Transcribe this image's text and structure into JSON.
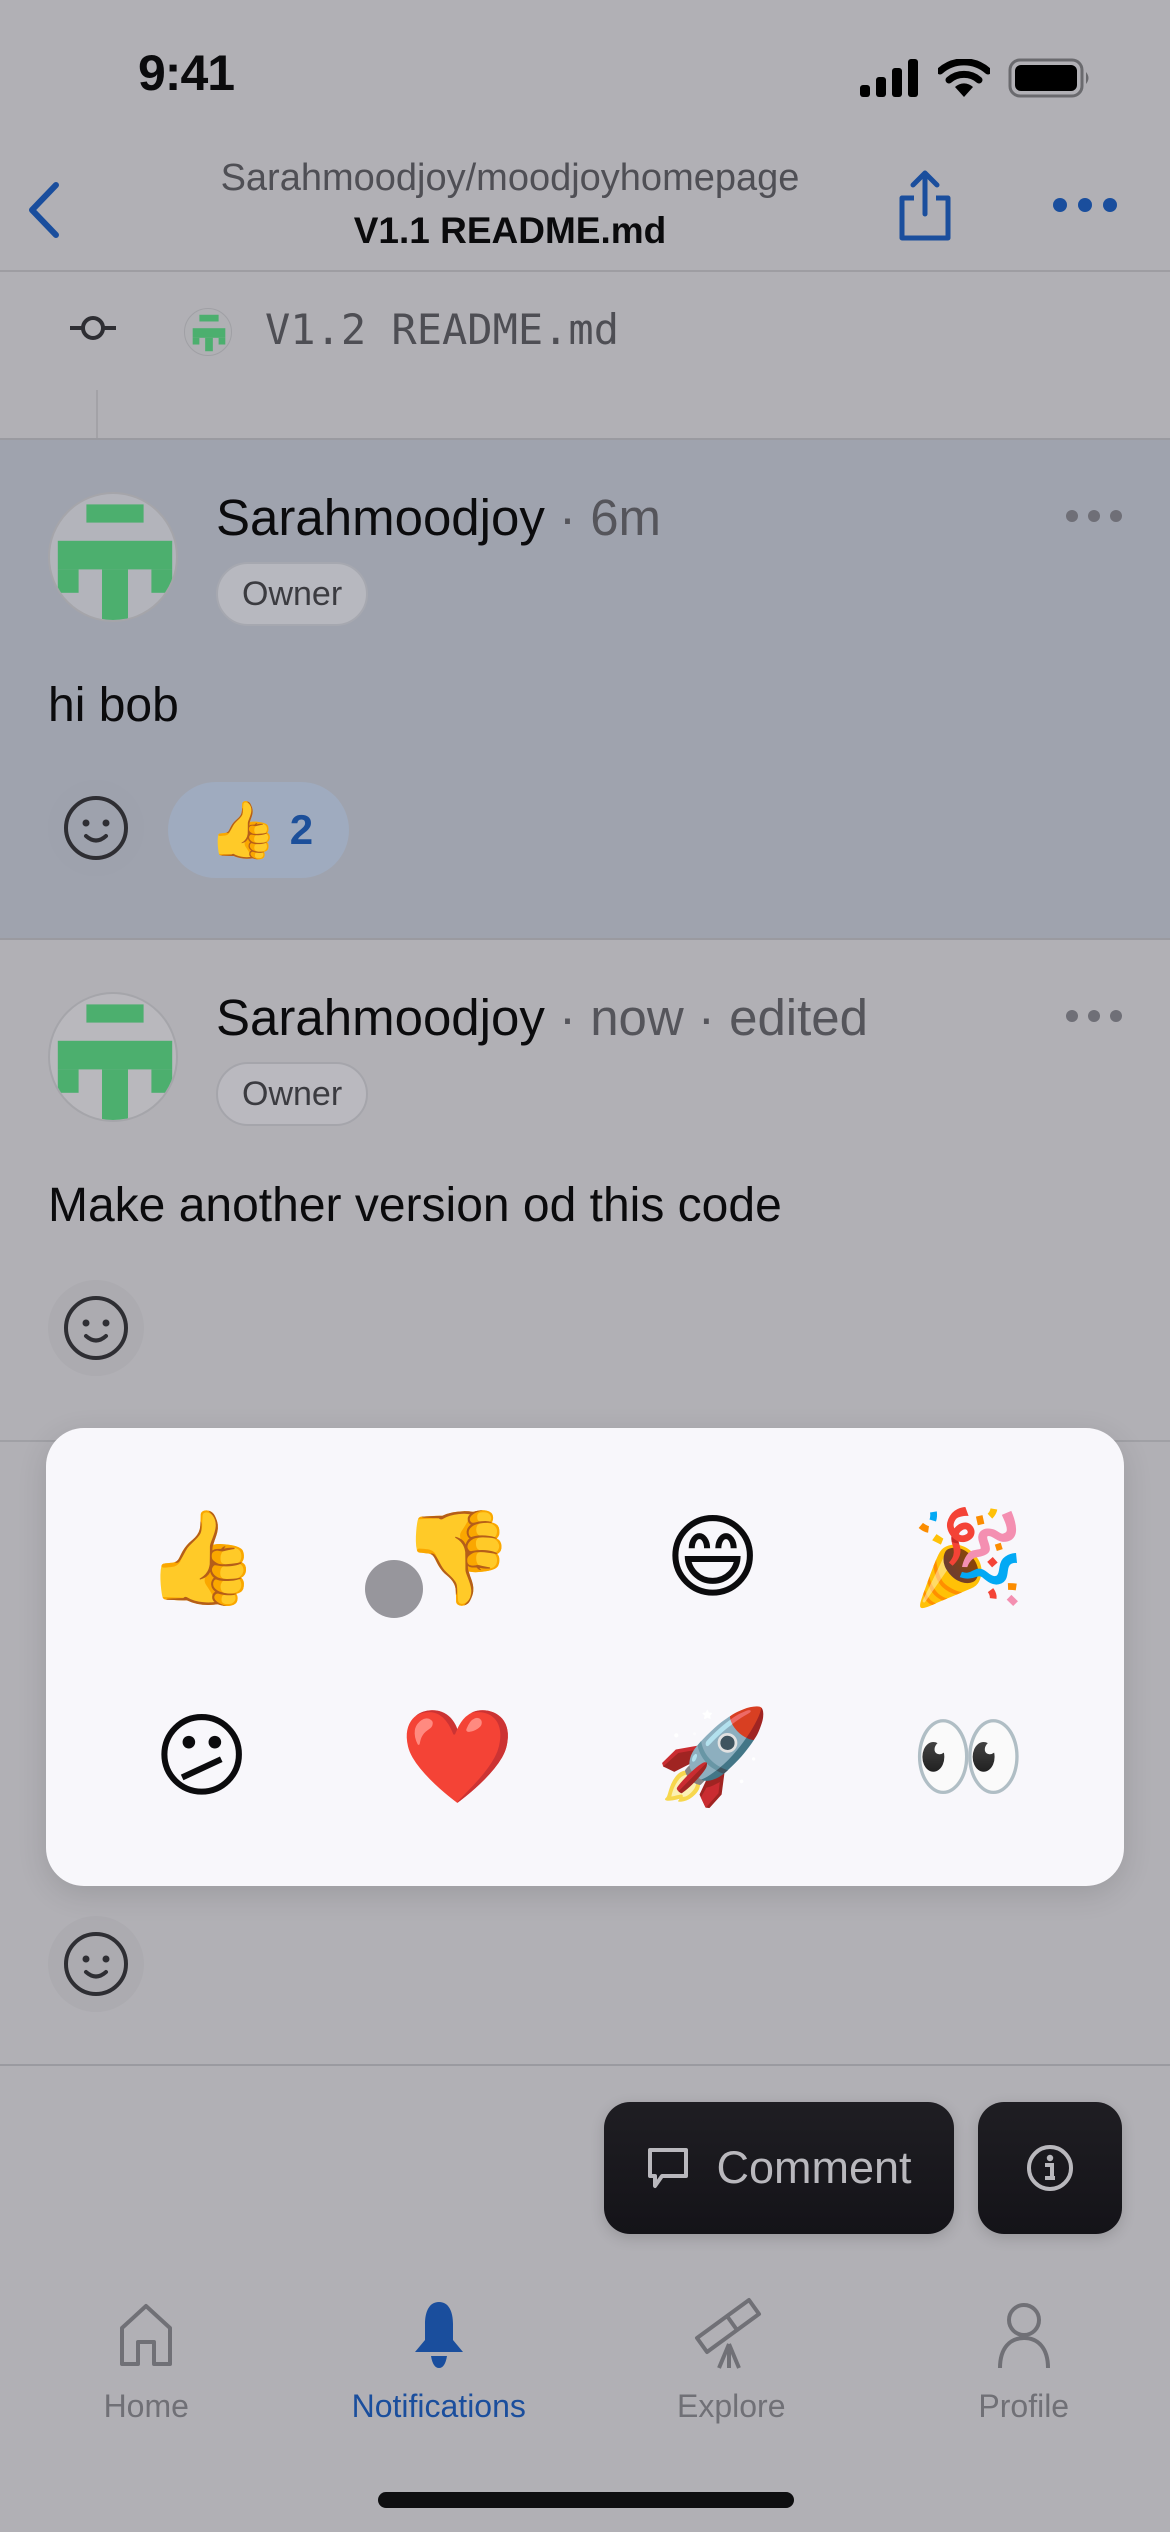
{
  "status_bar": {
    "time": "9:41",
    "signal_icon": "cellular-signal-icon",
    "wifi_icon": "wifi-icon",
    "battery_icon": "battery-icon"
  },
  "header": {
    "back_icon": "chevron-left-icon",
    "repo": "Sarahmoodjoy/moodjoyhomepage",
    "title": "V1.1 README.md",
    "share_icon": "share-icon",
    "more_icon": "ellipsis-icon"
  },
  "commit": {
    "icon": "git-commit-icon",
    "label": "V1.2 README.md"
  },
  "comments": [
    {
      "author": "Sarahmoodjoy",
      "meta": " · 6m",
      "badge": "Owner",
      "body": "hi bob",
      "highlighted": true,
      "reactions": [
        {
          "emoji": "👍",
          "name": "thumbs-up",
          "count": "2"
        }
      ]
    },
    {
      "author": "Sarahmoodjoy",
      "meta": " · now · edited",
      "badge": "Owner",
      "body": "Make another version od this code",
      "highlighted": false,
      "reactions": []
    },
    {
      "reactions": []
    }
  ],
  "emoji_picker": {
    "options": [
      {
        "emoji": "👍",
        "name": "thumbs-up"
      },
      {
        "emoji": "👎",
        "name": "thumbs-down"
      },
      {
        "emoji": "😄",
        "name": "laugh"
      },
      {
        "emoji": "🎉",
        "name": "hooray"
      },
      {
        "emoji": "😕",
        "name": "confused"
      },
      {
        "emoji": "❤️",
        "name": "heart"
      },
      {
        "emoji": "🚀",
        "name": "rocket"
      },
      {
        "emoji": "👀",
        "name": "eyes"
      }
    ]
  },
  "actions": {
    "comment_label": "Comment",
    "comment_icon": "comment-bubble-icon",
    "info_icon": "info-icon"
  },
  "tabbar": {
    "active": "Notifications",
    "tabs": [
      {
        "label": "Home",
        "icon": "home-icon"
      },
      {
        "label": "Notifications",
        "icon": "bell-icon"
      },
      {
        "label": "Explore",
        "icon": "telescope-icon"
      },
      {
        "label": "Profile",
        "icon": "person-icon"
      }
    ]
  },
  "colors": {
    "accent": "#1a4e9d",
    "avatar_green": "#4caf6e",
    "highlight_bg": "#9fa3ae",
    "dim_bg": "#b1b0b5",
    "popover_bg": "#f8f7fb"
  }
}
